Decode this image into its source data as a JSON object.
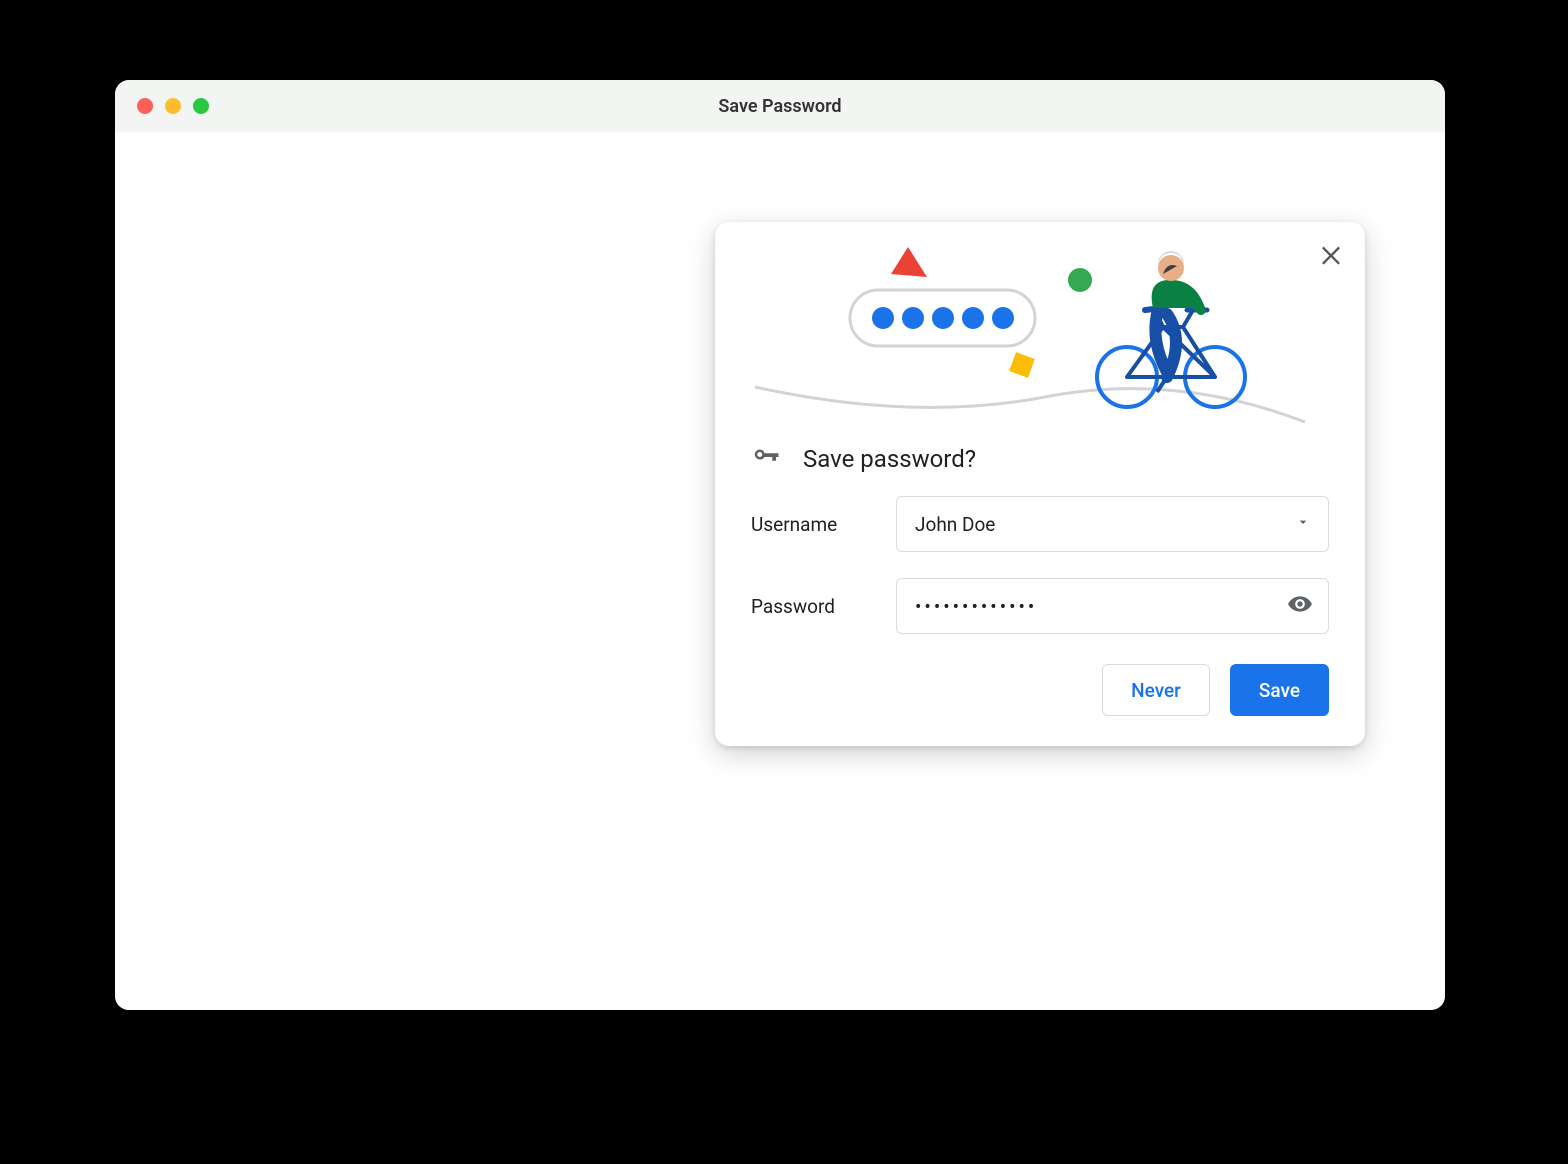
{
  "window": {
    "title": "Save Password"
  },
  "popover": {
    "heading": "Save password?",
    "username_label": "Username",
    "username_value": "John Doe",
    "password_label": "Password",
    "password_masked": "•••••••••••••",
    "never_label": "Never",
    "save_label": "Save"
  }
}
